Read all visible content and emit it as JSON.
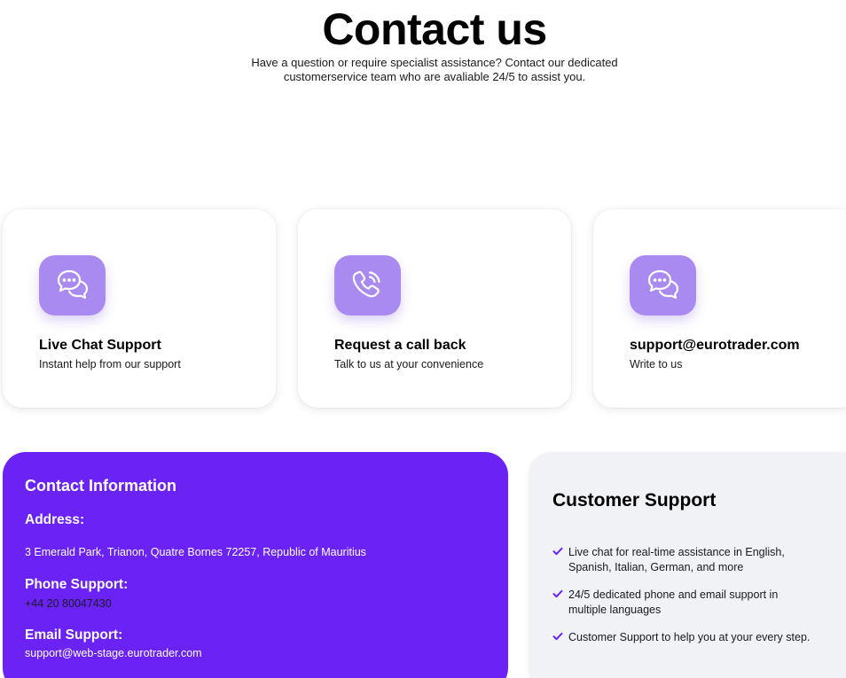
{
  "header": {
    "title": "Contact us",
    "subtitle_line1": "Have a question or require specialist assistance? Contact our dedicated",
    "subtitle_line2": "customerservice team who are avaliable 24/5 to assist you."
  },
  "cards": [
    {
      "icon": "chat-bubbles-icon",
      "title": "Live Chat Support",
      "subtitle": "Instant help from our support"
    },
    {
      "icon": "phone-ringing-icon",
      "title": "Request a call back",
      "subtitle": "Talk to us at your convenience"
    },
    {
      "icon": "chat-bubbles-icon",
      "title": "support@eurotrader.com",
      "subtitle": "Write to us"
    }
  ],
  "contact_info": {
    "heading": "Contact Information",
    "address_label": "Address:",
    "address_value": "3 Emerald Park, Trianon, Quatre Bornes 72257, Republic of Mauritius",
    "phone_label": "Phone Support:",
    "phone_value": "+44 20 80047430",
    "email_label": "Email Support:",
    "email_value": "support@web-stage.eurotrader.com"
  },
  "customer_support": {
    "heading": "Customer Support",
    "items": [
      {
        "line1": "Live chat for real-time assistance in English,",
        "line2": "Spanish, Italian, German, and more"
      },
      {
        "line1": "24/5 dedicated phone and email support in",
        "line2": "multiple languages"
      },
      {
        "line1": "Customer Support to help you at your every step.",
        "line2": ""
      }
    ]
  },
  "colors": {
    "accent_purple": "#6a22f5",
    "icon_tile": "#a98af0",
    "support_panel_bg": "#f1f2f5"
  }
}
